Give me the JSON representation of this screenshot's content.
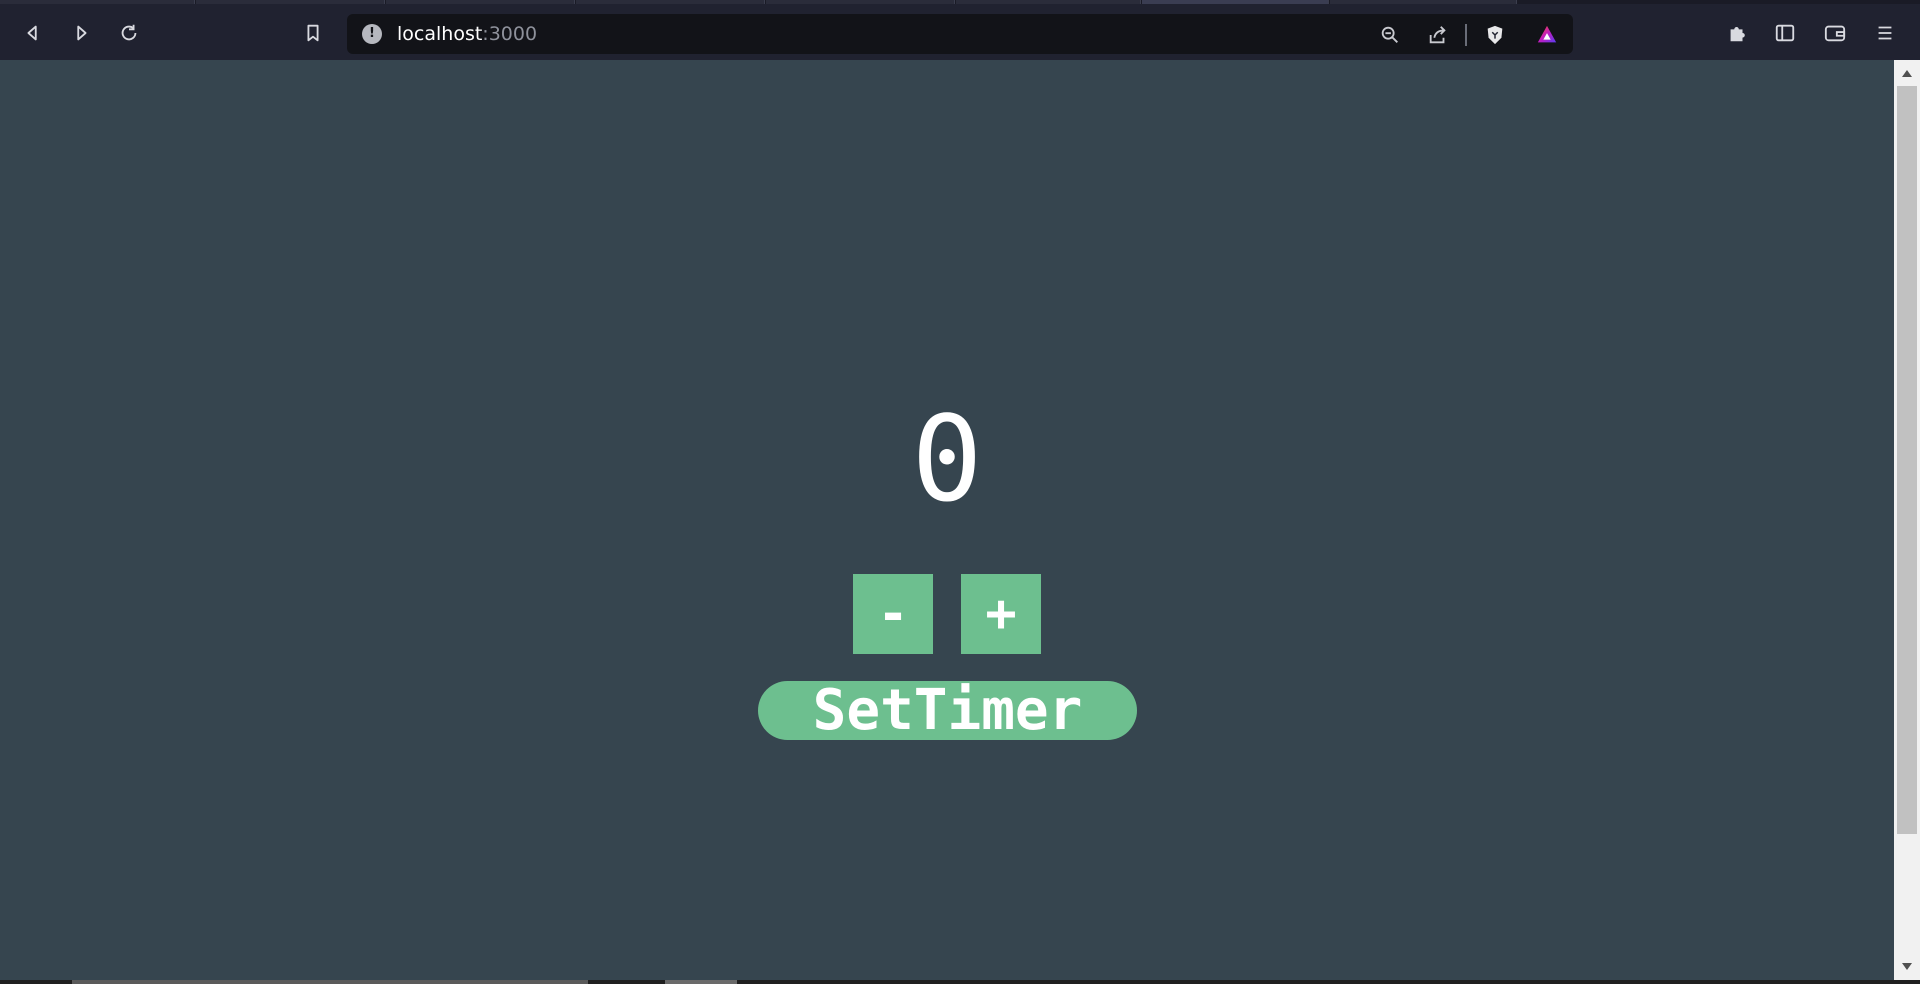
{
  "browser": {
    "url_host": "localhost",
    "url_port": ":3000",
    "icons": {
      "back": "back-arrow-icon",
      "forward": "forward-arrow-icon",
      "reload": "reload-icon",
      "bookmark": "bookmark-icon",
      "site_info": "info-icon",
      "zoom": "zoom-out-icon",
      "share": "share-icon",
      "shields": "brave-shields-icon",
      "rewards": "brave-rewards-icon",
      "extensions": "puzzle-icon",
      "sidebar": "sidebar-icon",
      "wallet": "wallet-icon",
      "menu": "menu-icon"
    }
  },
  "app": {
    "count": "0",
    "decrement_label": "-",
    "increment_label": "+",
    "set_timer_label": "SetTimer"
  },
  "colors": {
    "page_background": "#36454f",
    "button_green": "#6dbf8f",
    "toolbar": "#202230",
    "omnibox": "#121318"
  }
}
